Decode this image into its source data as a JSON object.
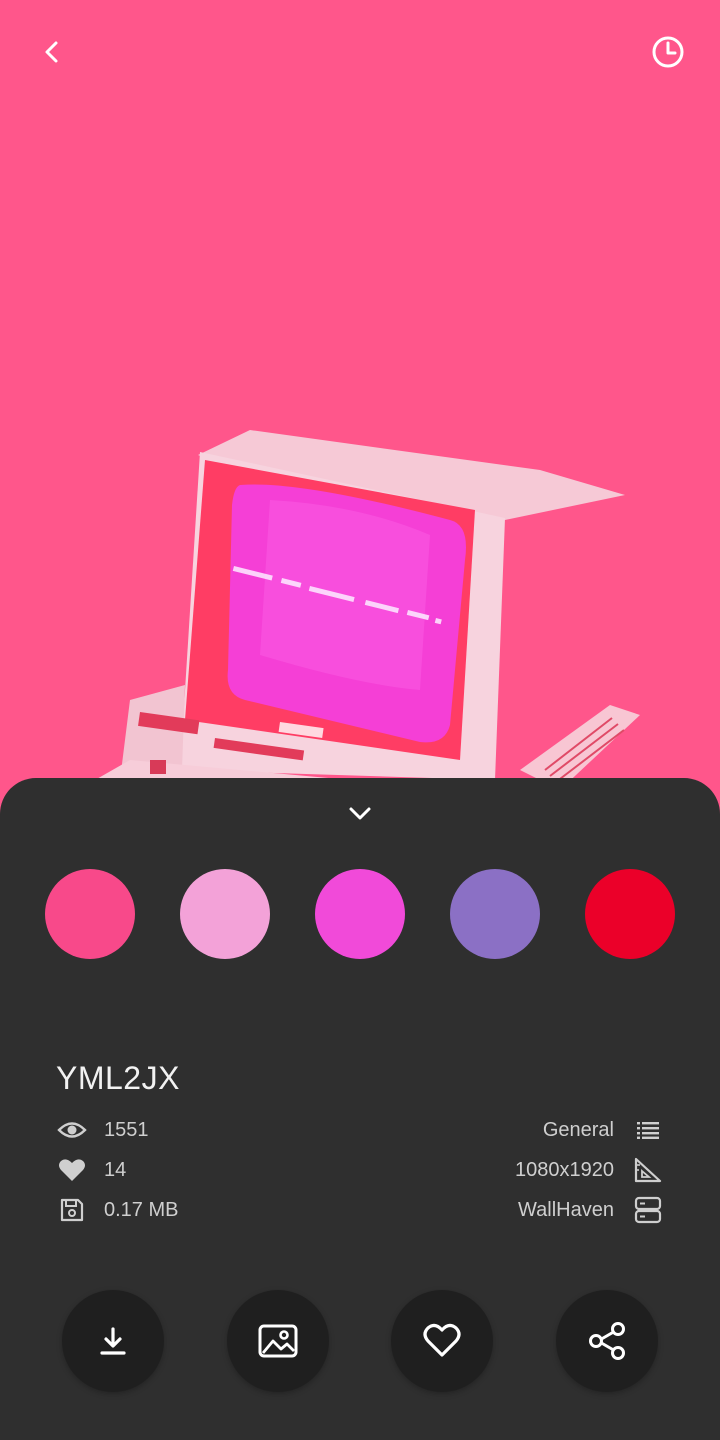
{
  "colors": {
    "wallpaper_bg": "#ff568b",
    "sheet_bg": "#2f2f2f",
    "action_bg": "#1f1f1f"
  },
  "icons": {
    "back": "chevron-left-icon",
    "history": "clock-icon",
    "collapse": "chevron-down-icon"
  },
  "palette": [
    "#f8498a",
    "#f3a2d8",
    "#f14ad9",
    "#8b70c5",
    "#eb0029"
  ],
  "wallpaper": {
    "id": "YML2JX",
    "views": "1551",
    "favorites": "14",
    "size": "0.17 MB",
    "category": "General",
    "resolution": "1080x1920",
    "source": "WallHaven"
  },
  "actions": [
    "download-icon",
    "set-wallpaper-icon",
    "favorite-icon",
    "share-icon"
  ]
}
